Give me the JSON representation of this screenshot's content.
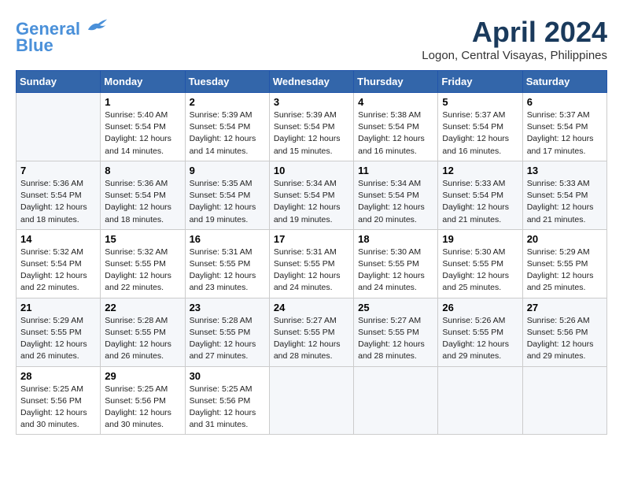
{
  "header": {
    "logo_line1": "General",
    "logo_line2": "Blue",
    "title": "April 2024",
    "subtitle": "Logon, Central Visayas, Philippines"
  },
  "columns": [
    "Sunday",
    "Monday",
    "Tuesday",
    "Wednesday",
    "Thursday",
    "Friday",
    "Saturday"
  ],
  "weeks": [
    {
      "days": [
        {
          "num": "",
          "info": ""
        },
        {
          "num": "1",
          "info": "Sunrise: 5:40 AM\nSunset: 5:54 PM\nDaylight: 12 hours\nand 14 minutes."
        },
        {
          "num": "2",
          "info": "Sunrise: 5:39 AM\nSunset: 5:54 PM\nDaylight: 12 hours\nand 14 minutes."
        },
        {
          "num": "3",
          "info": "Sunrise: 5:39 AM\nSunset: 5:54 PM\nDaylight: 12 hours\nand 15 minutes."
        },
        {
          "num": "4",
          "info": "Sunrise: 5:38 AM\nSunset: 5:54 PM\nDaylight: 12 hours\nand 16 minutes."
        },
        {
          "num": "5",
          "info": "Sunrise: 5:37 AM\nSunset: 5:54 PM\nDaylight: 12 hours\nand 16 minutes."
        },
        {
          "num": "6",
          "info": "Sunrise: 5:37 AM\nSunset: 5:54 PM\nDaylight: 12 hours\nand 17 minutes."
        }
      ]
    },
    {
      "days": [
        {
          "num": "7",
          "info": "Sunrise: 5:36 AM\nSunset: 5:54 PM\nDaylight: 12 hours\nand 18 minutes."
        },
        {
          "num": "8",
          "info": "Sunrise: 5:36 AM\nSunset: 5:54 PM\nDaylight: 12 hours\nand 18 minutes."
        },
        {
          "num": "9",
          "info": "Sunrise: 5:35 AM\nSunset: 5:54 PM\nDaylight: 12 hours\nand 19 minutes."
        },
        {
          "num": "10",
          "info": "Sunrise: 5:34 AM\nSunset: 5:54 PM\nDaylight: 12 hours\nand 19 minutes."
        },
        {
          "num": "11",
          "info": "Sunrise: 5:34 AM\nSunset: 5:54 PM\nDaylight: 12 hours\nand 20 minutes."
        },
        {
          "num": "12",
          "info": "Sunrise: 5:33 AM\nSunset: 5:54 PM\nDaylight: 12 hours\nand 21 minutes."
        },
        {
          "num": "13",
          "info": "Sunrise: 5:33 AM\nSunset: 5:54 PM\nDaylight: 12 hours\nand 21 minutes."
        }
      ]
    },
    {
      "days": [
        {
          "num": "14",
          "info": "Sunrise: 5:32 AM\nSunset: 5:54 PM\nDaylight: 12 hours\nand 22 minutes."
        },
        {
          "num": "15",
          "info": "Sunrise: 5:32 AM\nSunset: 5:55 PM\nDaylight: 12 hours\nand 22 minutes."
        },
        {
          "num": "16",
          "info": "Sunrise: 5:31 AM\nSunset: 5:55 PM\nDaylight: 12 hours\nand 23 minutes."
        },
        {
          "num": "17",
          "info": "Sunrise: 5:31 AM\nSunset: 5:55 PM\nDaylight: 12 hours\nand 24 minutes."
        },
        {
          "num": "18",
          "info": "Sunrise: 5:30 AM\nSunset: 5:55 PM\nDaylight: 12 hours\nand 24 minutes."
        },
        {
          "num": "19",
          "info": "Sunrise: 5:30 AM\nSunset: 5:55 PM\nDaylight: 12 hours\nand 25 minutes."
        },
        {
          "num": "20",
          "info": "Sunrise: 5:29 AM\nSunset: 5:55 PM\nDaylight: 12 hours\nand 25 minutes."
        }
      ]
    },
    {
      "days": [
        {
          "num": "21",
          "info": "Sunrise: 5:29 AM\nSunset: 5:55 PM\nDaylight: 12 hours\nand 26 minutes."
        },
        {
          "num": "22",
          "info": "Sunrise: 5:28 AM\nSunset: 5:55 PM\nDaylight: 12 hours\nand 26 minutes."
        },
        {
          "num": "23",
          "info": "Sunrise: 5:28 AM\nSunset: 5:55 PM\nDaylight: 12 hours\nand 27 minutes."
        },
        {
          "num": "24",
          "info": "Sunrise: 5:27 AM\nSunset: 5:55 PM\nDaylight: 12 hours\nand 28 minutes."
        },
        {
          "num": "25",
          "info": "Sunrise: 5:27 AM\nSunset: 5:55 PM\nDaylight: 12 hours\nand 28 minutes."
        },
        {
          "num": "26",
          "info": "Sunrise: 5:26 AM\nSunset: 5:55 PM\nDaylight: 12 hours\nand 29 minutes."
        },
        {
          "num": "27",
          "info": "Sunrise: 5:26 AM\nSunset: 5:56 PM\nDaylight: 12 hours\nand 29 minutes."
        }
      ]
    },
    {
      "days": [
        {
          "num": "28",
          "info": "Sunrise: 5:25 AM\nSunset: 5:56 PM\nDaylight: 12 hours\nand 30 minutes."
        },
        {
          "num": "29",
          "info": "Sunrise: 5:25 AM\nSunset: 5:56 PM\nDaylight: 12 hours\nand 30 minutes."
        },
        {
          "num": "30",
          "info": "Sunrise: 5:25 AM\nSunset: 5:56 PM\nDaylight: 12 hours\nand 31 minutes."
        },
        {
          "num": "",
          "info": ""
        },
        {
          "num": "",
          "info": ""
        },
        {
          "num": "",
          "info": ""
        },
        {
          "num": "",
          "info": ""
        }
      ]
    }
  ]
}
